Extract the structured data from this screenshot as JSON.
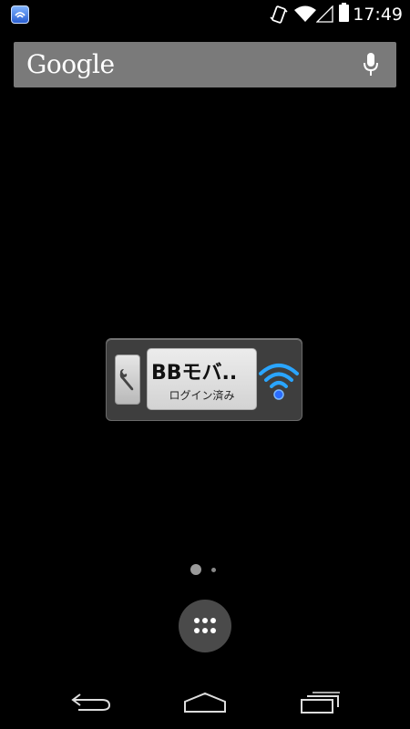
{
  "status_bar": {
    "time": "17:49",
    "icons": [
      "app-notification-icon",
      "vibrate-icon",
      "wifi-icon",
      "signal-icon",
      "battery-icon"
    ]
  },
  "search_bar": {
    "logo_text": "Google",
    "icons": [
      "mic-icon"
    ]
  },
  "widget": {
    "service_name": "BBモバ..",
    "login_status": "ログイン済み",
    "icons": [
      "wrench-icon",
      "wifi-icon"
    ],
    "colors": {
      "wifi_accent": "#2aa5ff",
      "panel": "#e0e0e0"
    }
  },
  "home": {
    "page_count": 2,
    "current_page": 1
  },
  "dock": {
    "icons": [
      "app-drawer-icon"
    ]
  },
  "nav_bar": {
    "icons": [
      "back-icon",
      "home-icon",
      "recents-icon"
    ]
  }
}
